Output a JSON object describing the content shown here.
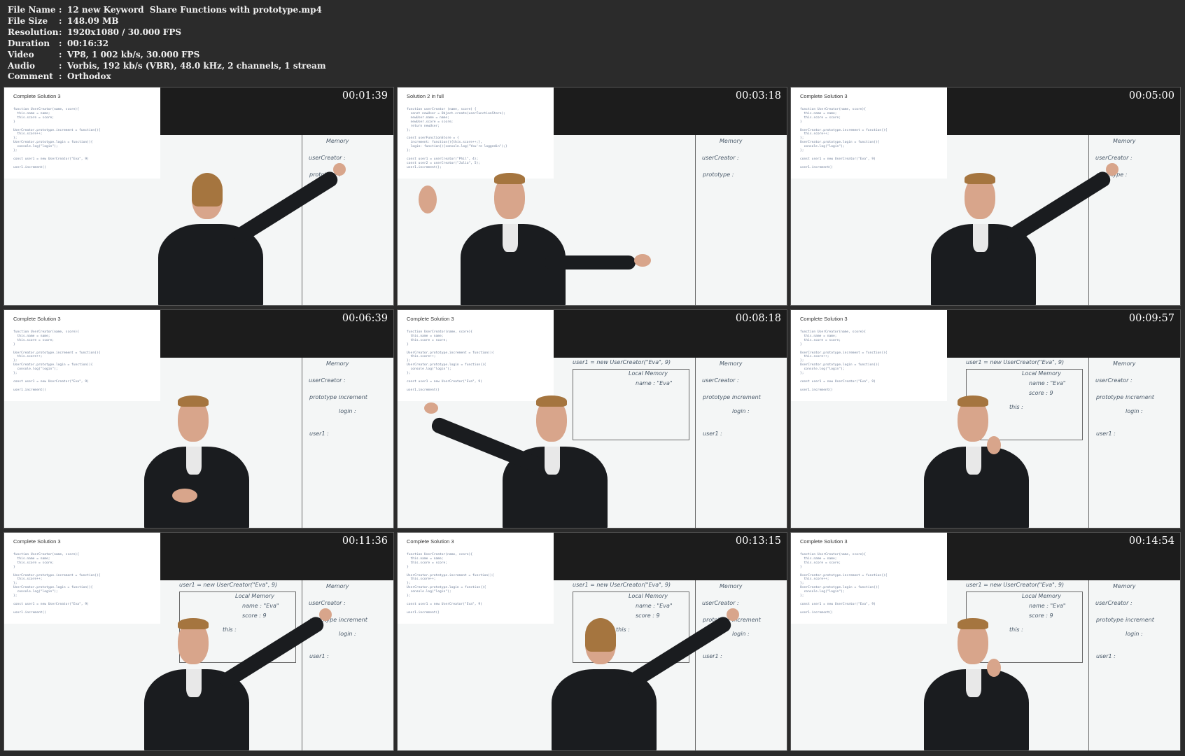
{
  "file_info": {
    "rows": [
      {
        "key": "File Name",
        "value": "12 new Keyword  Share Functions with prototype.mp4"
      },
      {
        "key": "File Size",
        "value": "148.09 MB"
      },
      {
        "key": "Resolution",
        "value": "1920x1080 / 30.000 FPS"
      },
      {
        "key": "Duration",
        "value": "00:16:32"
      },
      {
        "key": "Video",
        "value": "VP8, 1 002 kb/s, 30.000 FPS"
      },
      {
        "key": "Audio",
        "value": "Vorbis, 192 kb/s (VBR), 48.0 kHz, 2 channels, 1 stream"
      },
      {
        "key": "Comment",
        "value": "Orthodox"
      }
    ]
  },
  "code_sol3": "function UserCreator(name, score){\n  this.name = name;\n  this.score = score;\n}\n\nUserCreator.prototype.increment = function(){\n  this.score++;\n};\nUserCreator.prototype.login = function(){\n  console.log(\"login\");\n};\n\nconst user1 = new UserCreator(\"Eva\", 9)\n\nuser1.increment()",
  "code_sol2": "function userCreator (name, score) {\n  const newUser = Object.create(userFunctionStore);\n  newUser.name = name;\n  newUser.score = score;\n  return newUser;\n};\n\nconst userFunctionStore = {\n  increment: function(){this.score++;},\n  login: function(){console.log(\"You're loggedin\");}\n};\n\nconst user1 = userCreator(\"Phil\", 4);\nconst user2 = userCreator(\"Julia\", 5);\nuser1.increment();",
  "thumbnails": [
    {
      "title": "Complete Solution 3",
      "time": "00:01:39",
      "code": "sol3",
      "pose": "back"
    },
    {
      "title": "Solution 2 in full",
      "time": "00:03:18",
      "code": "sol2",
      "pose": "arms"
    },
    {
      "title": "Complete Solution 3",
      "time": "00:05:00",
      "code": "sol3",
      "pose": "point-right"
    },
    {
      "title": "Complete Solution 3",
      "time": "00:06:39",
      "code": "sol3",
      "pose": "stand"
    },
    {
      "title": "Complete Solution 3",
      "time": "00:08:18",
      "code": "sol3",
      "pose": "point-left"
    },
    {
      "title": "Complete Solution 3",
      "time": "00:09:57",
      "code": "sol3",
      "pose": "front"
    },
    {
      "title": "Complete Solution 3",
      "time": "00:11:36",
      "code": "sol3",
      "pose": "point-right"
    },
    {
      "title": "Complete Solution 3",
      "time": "00:13:15",
      "code": "sol3",
      "pose": "back"
    },
    {
      "title": "Complete Solution 3",
      "time": "00:14:54",
      "code": "sol3",
      "pose": "front"
    }
  ],
  "board": {
    "memory": "Memory",
    "user_creator": "userCreator :",
    "prototype": "prototype :",
    "increment": "increment",
    "login": "login :",
    "user1": "user1 :",
    "local_memory": "Local Memory",
    "name": "name : \"Eva\"",
    "score": "score : 9",
    "this": "this :",
    "new_call": "user1 = new UserCreator(\"Eva\", 9)"
  },
  "colors": {
    "background": "#2b2b2b",
    "board": "#f4f6f6",
    "band": "#1c1c1c",
    "jacket": "#1a1c1f"
  }
}
